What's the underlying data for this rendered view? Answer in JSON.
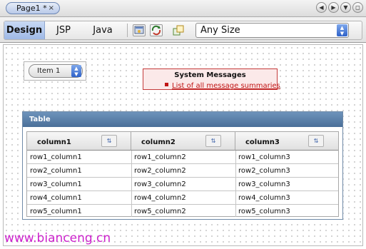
{
  "tab": {
    "label": "Page1 *",
    "close": "×"
  },
  "toolbar": {
    "views": [
      "Design",
      "JSP",
      "Java"
    ],
    "size_select": {
      "value": "Any Size"
    }
  },
  "canvas": {
    "dropdown": {
      "value": "Item 1"
    },
    "messages": {
      "title": "System Messages",
      "link": "List of all message summaries"
    },
    "table": {
      "title": "Table",
      "columns": [
        "column1",
        "column2",
        "column3"
      ],
      "rows": [
        [
          "row1_column1",
          "row1_column2",
          "row1_column3"
        ],
        [
          "row2_column1",
          "row2_column2",
          "row2_column3"
        ],
        [
          "row3_column1",
          "row3_column2",
          "row3_column3"
        ],
        [
          "row4_column1",
          "row4_column2",
          "row4_column3"
        ],
        [
          "row5_column1",
          "row5_column2",
          "row5_column3"
        ]
      ]
    }
  },
  "watermark": "www.bianceng.cn",
  "colors": {
    "accent": "#4a6f99",
    "error": "#c01515",
    "watermark": "#cc22cc"
  },
  "icons": [
    "back-icon",
    "forward-icon",
    "down-circle-icon",
    "restore-icon",
    "preview-icon",
    "refresh-icon",
    "layout-icon",
    "sort-icon"
  ]
}
